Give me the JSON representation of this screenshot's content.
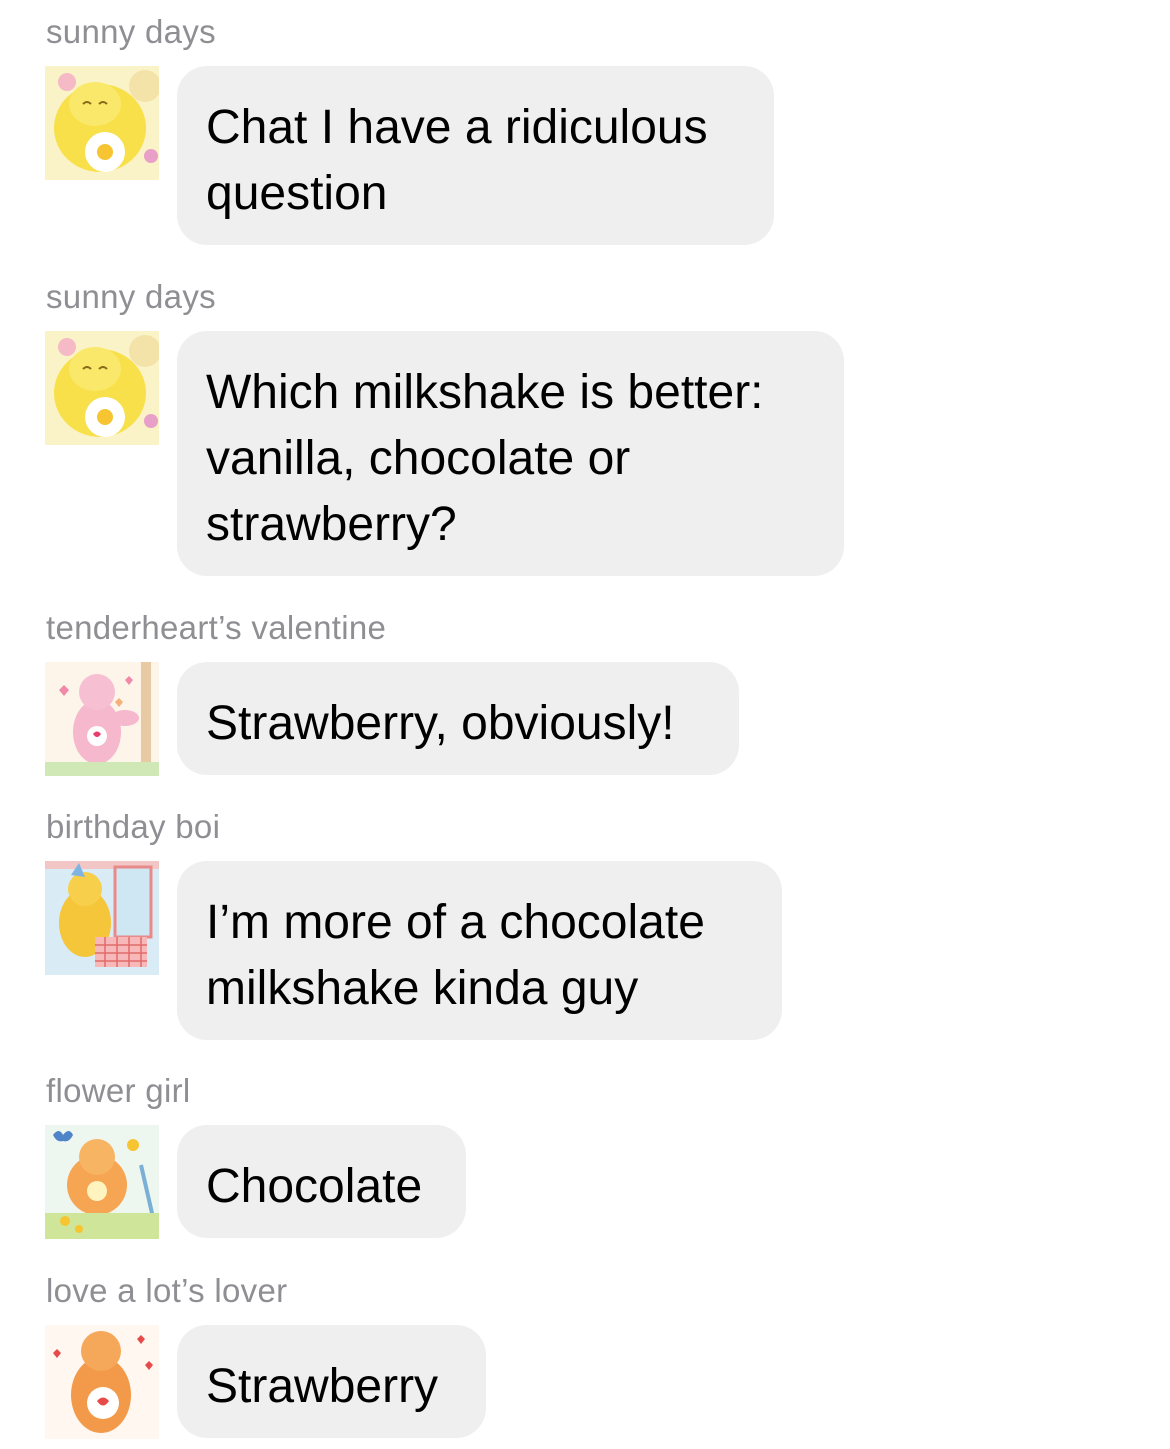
{
  "messages": [
    {
      "sender": "sunny days",
      "avatar_icon": "funshine-bear-avatar-icon",
      "text": "Chat I have a ridiculous question"
    },
    {
      "sender": "sunny days",
      "avatar_icon": "funshine-bear-avatar-icon",
      "text": "Which milkshake is better: vanilla, chocolate or strawberry?"
    },
    {
      "sender": "tenderheart’s valentine",
      "avatar_icon": "pink-bear-avatar-icon",
      "text": "Strawberry, obviously!"
    },
    {
      "sender": "birthday boi",
      "avatar_icon": "birthday-bear-avatar-icon",
      "text": "I’m more of a chocolate milkshake kinda guy"
    },
    {
      "sender": "flower girl",
      "avatar_icon": "friend-bear-avatar-icon",
      "text": "Chocolate"
    },
    {
      "sender": "love a lot’s lover",
      "avatar_icon": "orange-bear-avatar-icon",
      "text": "Strawberry"
    }
  ],
  "colors": {
    "bubble_background": "#efefef",
    "sender_name": "#8e8e93",
    "message_text": "#000000",
    "page_background": "#ffffff"
  }
}
